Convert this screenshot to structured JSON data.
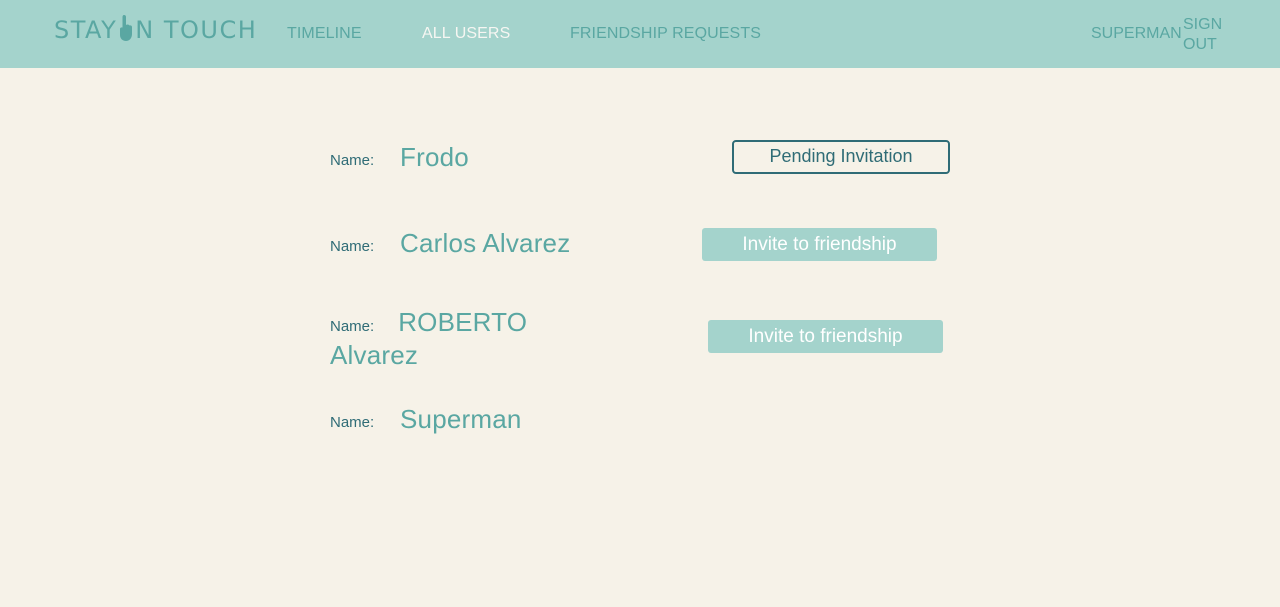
{
  "header": {
    "brand_left": "STAY ",
    "brand_right": "N TOUCH",
    "logo_icon": "hand-pointer-icon",
    "nav": {
      "timeline": "TIMELINE",
      "all_users": "ALL USERS",
      "friendship_requests": "FRIENDSHIP REQUESTS"
    },
    "current_user": "SUPERMAN",
    "sign_out": "SIGN OUT"
  },
  "users": [
    {
      "label": "Name:",
      "name": "Frodo",
      "action": "Pending Invitation",
      "action_type": "pending"
    },
    {
      "label": "Name:",
      "name": "Carlos Alvarez",
      "action": "Invite to friendship",
      "action_type": "invite"
    },
    {
      "label": "Name:",
      "name": "ROBERTO Alvarez",
      "action": "Invite to friendship",
      "action_type": "invite"
    },
    {
      "label": "Name:",
      "name": "Superman",
      "action": "",
      "action_type": "none"
    }
  ],
  "colors": {
    "navbar": "#a4d3cc",
    "background": "#f6f2e8",
    "accent": "#5aa7a2",
    "dark_teal": "#2f6c76",
    "active_nav": "#f6f6f2"
  }
}
